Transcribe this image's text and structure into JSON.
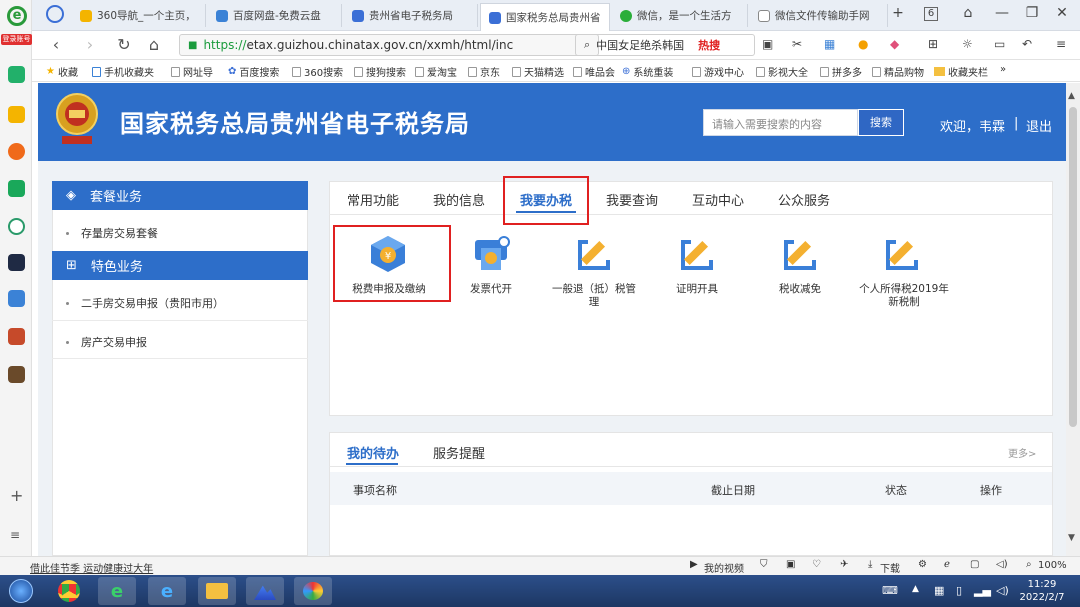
{
  "browser": {
    "login_badge": "登录账号",
    "tabs": [
      {
        "label": "360导航_一个主页，",
        "color": "#2a8a2a"
      },
      {
        "label": "百度网盘-免费云盘",
        "color": "#3b82d6"
      },
      {
        "label": "贵州省电子税务局",
        "color": "#3b6fd6"
      },
      {
        "label": "国家税务总局贵州省",
        "color": "#3b6fd6"
      },
      {
        "label": "微信，是一个生活方",
        "color": "#2aae3a"
      },
      {
        "label": "微信文件传输助手网",
        "color": "#888888"
      }
    ],
    "new_tab": "+",
    "tab_count": "6",
    "url_protocol": "https://",
    "url_rest": "etax.guizhou.chinatax.gov.cn/xxmh/html/inc",
    "search_text": "中国女足绝杀韩国",
    "hot_label": "热搜",
    "bookmarks": [
      "收藏",
      "手机收藏夹",
      "网址导",
      "百度搜索",
      "360搜索",
      "搜狗搜索",
      "爱淘宝",
      "京东",
      "天猫精选",
      "唯品会",
      "系统重装",
      "游戏中心",
      "影视大全",
      "拼多多",
      "精品购物",
      "收藏夹栏",
      "»"
    ]
  },
  "site": {
    "title": "国家税务总局贵州省电子税务局",
    "search_placeholder": "请输入需要搜索的内容",
    "search_button": "搜索",
    "welcome": "欢迎，韦霖",
    "separator": "|",
    "logout": "退出"
  },
  "sidebar": {
    "sections": [
      {
        "title": "套餐业务",
        "items": [
          "存量房交易套餐"
        ]
      },
      {
        "title": "特色业务",
        "items": [
          "二手房交易申报（贵阳市用）",
          "房产交易申报"
        ]
      }
    ]
  },
  "main": {
    "tabs": [
      "常用功能",
      "我的信息",
      "我要办税",
      "我要查询",
      "互动中心",
      "公众服务"
    ],
    "active_tab": 2,
    "services": [
      {
        "label": "税费申报及缴纳",
        "icon": "cube-icon"
      },
      {
        "label": "发票代开",
        "icon": "printer-icon"
      },
      {
        "label": "一般退（抵）税管理",
        "icon": "pencil-icon"
      },
      {
        "label": "证明开具",
        "icon": "pencil-icon"
      },
      {
        "label": "税收减免",
        "icon": "pencil-icon"
      },
      {
        "label": "个人所得税2019年新税制",
        "icon": "pencil-icon"
      }
    ]
  },
  "todo": {
    "tabs": [
      "我的待办",
      "服务提醒"
    ],
    "more": "更多>",
    "columns": [
      "事项名称",
      "截止日期",
      "状态",
      "操作"
    ]
  },
  "statusbar": {
    "left": "借此佳节季 运动健康过大年",
    "video": "我的视频",
    "download": "下载",
    "zoom": "100%"
  },
  "taskbar": {
    "time": "11:29",
    "date": "2022/2/7"
  },
  "colors": {
    "brand": "#2d6ec9",
    "highlight": "#e02020"
  }
}
